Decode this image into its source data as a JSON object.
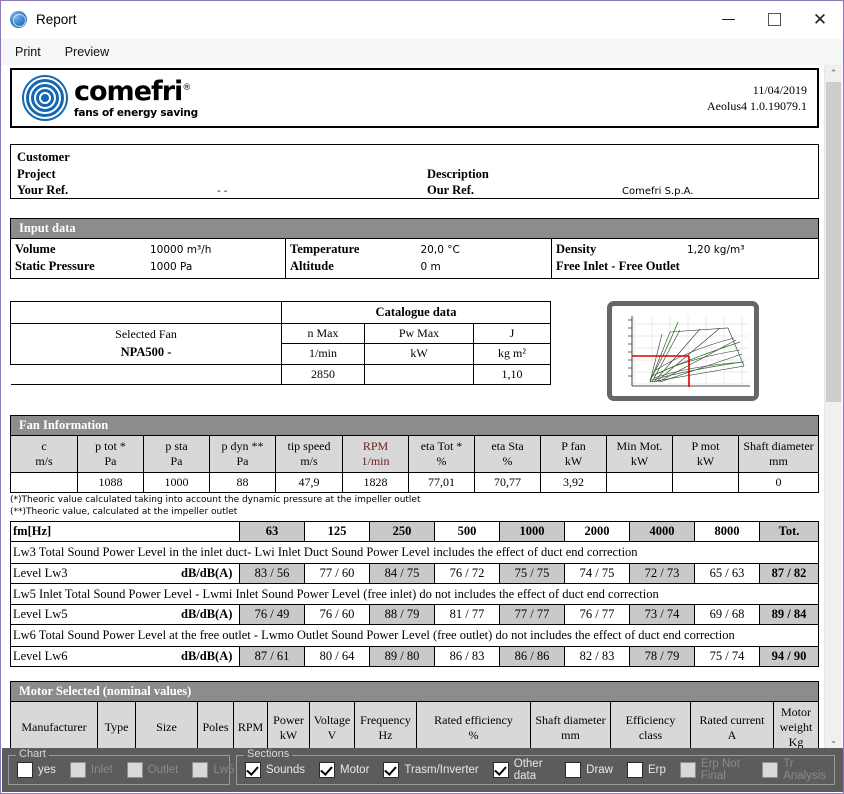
{
  "window": {
    "title": "Report",
    "icon": "globe-icon",
    "minimize": "–",
    "maximize": "□",
    "close": "✕"
  },
  "menu": {
    "items": [
      "Print",
      "Preview"
    ]
  },
  "report_header": {
    "brand": "comefri",
    "brand_reg": "®",
    "tagline": "fans of energy saving",
    "date": "11/04/2019",
    "version": "Aeolus4 1.0.19079.1"
  },
  "customer": {
    "customer_label": "Customer",
    "customer_value": "",
    "project_label": "Project",
    "project_value": "",
    "your_ref_label": "Your Ref.",
    "your_ref_value": "- -",
    "description_label": "Description",
    "description_value": "",
    "our_ref_label": "Our Ref.",
    "our_ref_value": "Comefri S.p.A."
  },
  "input_data": {
    "title": "Input data",
    "volume_label": "Volume",
    "volume_value": "10000 m³/h",
    "static_pressure_label": "Static Pressure",
    "static_pressure_value": "1000  Pa",
    "temperature_label": "Temperature",
    "temperature_value": "20,0 °C",
    "altitude_label": "Altitude",
    "altitude_value": "0   m",
    "density_label": "Density",
    "density_value": "1,20  kg/m³",
    "inlet_outlet": "Free Inlet - Free Outlet"
  },
  "catalogue": {
    "title": "Catalogue data",
    "selected_fan_label": "Selected Fan",
    "selected_fan_name": "NPA500 -",
    "columns": [
      {
        "name": "n Max",
        "unit": "1/min",
        "value": "2850"
      },
      {
        "name": "Pw Max",
        "unit": "kW",
        "value": ""
      },
      {
        "name": "J",
        "unit": "kg m²",
        "value": "1,10"
      }
    ]
  },
  "fan_information": {
    "title": "Fan Information",
    "columns": [
      {
        "name": "c",
        "unit": "m/s"
      },
      {
        "name": "p tot  *",
        "unit": "Pa"
      },
      {
        "name": "p sta",
        "unit": "Pa"
      },
      {
        "name": "p dyn  **",
        "unit": "Pa"
      },
      {
        "name": "tip speed",
        "unit": "m/s"
      },
      {
        "name": "RPM",
        "unit": "1/min"
      },
      {
        "name": "eta Tot  *",
        "unit": "%"
      },
      {
        "name": "eta Sta",
        "unit": "%"
      },
      {
        "name": "P fan",
        "unit": "kW"
      },
      {
        "name": "Min Mot.",
        "unit": "kW"
      },
      {
        "name": "P mot",
        "unit": "kW"
      },
      {
        "name": "Shaft diameter",
        "unit": "mm"
      }
    ],
    "values": [
      "",
      "1088",
      "1000",
      "88",
      "47,9",
      "1828",
      "77,01",
      "70,77",
      "3,92",
      "",
      "",
      "0"
    ],
    "footnote1": "(*)Theoric value calculated taking into account the dynamic pressure at the impeller outlet",
    "footnote2": "(**)Theoric value, calculated at the impeller outlet"
  },
  "sound": {
    "fm_label": "fm[Hz]",
    "frequencies": [
      "63",
      "125",
      "250",
      "500",
      "1000",
      "2000",
      "4000",
      "8000"
    ],
    "total_label": "Tot.",
    "blocks": [
      {
        "description": "Lw3 Total Sound Power Level in the inlet duct- Lwi Inlet Duct Sound Power Level includes the effect of duct end correction",
        "row_label": "Level Lw3",
        "row_unit": "dB/dB(A)",
        "values": [
          "83 / 56",
          "77 / 60",
          "84 / 75",
          "76 / 72",
          "75 / 75",
          "74 / 75",
          "72 / 73",
          "65 / 63"
        ],
        "total": "87 / 82"
      },
      {
        "description": "Lw5 Inlet Total Sound Power Level - Lwmi Inlet Sound Power Level (free inlet) do not includes the effect of duct end correction",
        "row_label": "Level Lw5",
        "row_unit": "dB/dB(A)",
        "values": [
          "76 / 49",
          "76 / 60",
          "88 / 79",
          "81 / 77",
          "77 / 77",
          "76 / 77",
          "73 / 74",
          "69 / 68"
        ],
        "total": "89 / 84"
      },
      {
        "description": "Lw6 Total Sound Power Level at the free outlet - Lwmo Outlet Sound Power Level (free outlet) do not includes the effect of duct end correction",
        "row_label": "Level Lw6",
        "row_unit": "dB/dB(A)",
        "values": [
          "87 / 61",
          "80 / 64",
          "89 / 80",
          "86 / 83",
          "86 / 86",
          "82 / 83",
          "78 / 79",
          "75 / 74"
        ],
        "total": "94 / 90"
      }
    ]
  },
  "motor": {
    "title": "Motor Selected (nominal values)",
    "columns": [
      {
        "name": "Manufacturer",
        "unit": ""
      },
      {
        "name": "Type",
        "unit": ""
      },
      {
        "name": "Size",
        "unit": ""
      },
      {
        "name": "Poles",
        "unit": ""
      },
      {
        "name": "RPM",
        "unit": ""
      },
      {
        "name": "Power",
        "unit": "kW"
      },
      {
        "name": "Voltage",
        "unit": "V"
      },
      {
        "name": "Frequency",
        "unit": "Hz"
      },
      {
        "name": "Rated efficiency",
        "unit": "%"
      },
      {
        "name": "Shaft diameter",
        "unit": "mm"
      },
      {
        "name": "Efficiency",
        "unit": "class"
      },
      {
        "name": "Rated current",
        "unit": "A"
      },
      {
        "name": "Motor",
        "unit": "weight Kg"
      }
    ]
  },
  "bottom_panel": {
    "chart_group_label": "Chart",
    "chart_options": [
      {
        "label": "yes",
        "checked": false,
        "enabled": true
      },
      {
        "label": "Inlet",
        "checked": false,
        "enabled": false
      },
      {
        "label": "Outlet",
        "checked": false,
        "enabled": false
      },
      {
        "label": "Lw5",
        "checked": false,
        "enabled": false
      }
    ],
    "sections_group_label": "Sections",
    "section_options": [
      {
        "label": "Sounds",
        "checked": true,
        "enabled": true
      },
      {
        "label": "Motor",
        "checked": true,
        "enabled": true
      },
      {
        "label": "Trasm/Inverter",
        "checked": true,
        "enabled": true
      },
      {
        "label": "Other data",
        "checked": true,
        "enabled": true
      },
      {
        "label": "Draw",
        "checked": false,
        "enabled": true
      },
      {
        "label": "Erp",
        "checked": false,
        "enabled": true
      },
      {
        "label": "Erp Not Final",
        "checked": false,
        "enabled": false
      },
      {
        "label": "Tr Analysis",
        "checked": false,
        "enabled": false
      }
    ]
  },
  "scrollbar": {
    "up": "⌃",
    "down": "⌄"
  }
}
